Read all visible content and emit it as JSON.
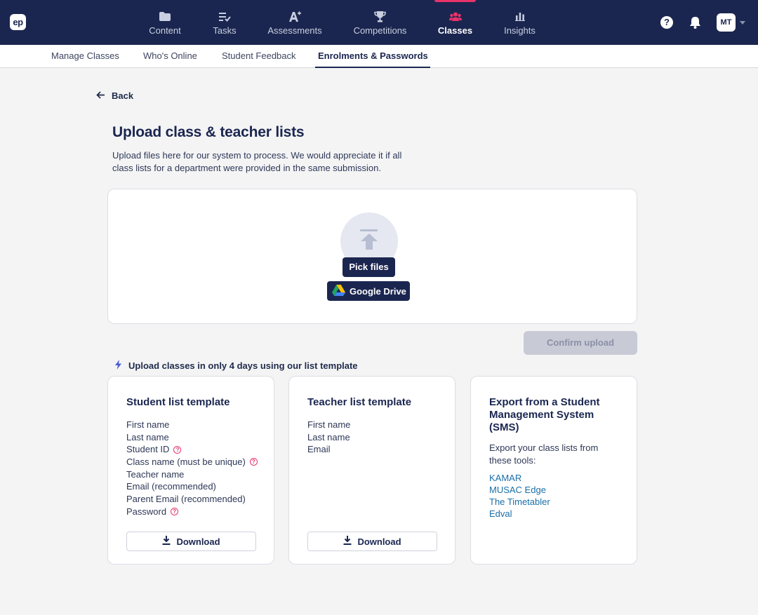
{
  "logo": "ep",
  "nav": {
    "items": [
      {
        "label": "Content",
        "icon": "folder-icon"
      },
      {
        "label": "Tasks",
        "icon": "tasks-icon"
      },
      {
        "label": "Assessments",
        "icon": "assessment-icon"
      },
      {
        "label": "Competitions",
        "icon": "trophy-icon"
      },
      {
        "label": "Classes",
        "icon": "people-icon",
        "active": true
      },
      {
        "label": "Insights",
        "icon": "chart-icon"
      }
    ],
    "help": "?",
    "avatar_initials": "MT",
    "active_color": "#e8336b",
    "bg_color": "#1b2650"
  },
  "subnav": {
    "tabs": [
      {
        "label": "Manage Classes"
      },
      {
        "label": "Who's Online"
      },
      {
        "label": "Student Feedback"
      },
      {
        "label": "Enrolments & Passwords",
        "active": true
      }
    ]
  },
  "back_label": "Back",
  "page": {
    "title": "Upload class & teacher lists",
    "description": "Upload files here for our system to process. We would appreciate it if all class lists for a department were provided in the same submission."
  },
  "upload": {
    "pick_files_label": "Pick files",
    "google_drive_label": "Google Drive",
    "confirm_label": "Confirm upload"
  },
  "promo_text": "Upload classes in only 4 days using our list template",
  "student_card": {
    "title": "Student list template",
    "fields": [
      "First name",
      "Last name",
      "Student ID",
      "Class name (must be unique)",
      "Teacher name",
      "Email (recommended)",
      "Parent Email (recommended)",
      "Password"
    ],
    "download_label": "Download"
  },
  "teacher_card": {
    "title": "Teacher list template",
    "fields": [
      "First name",
      "Last name",
      "Email"
    ],
    "download_label": "Download"
  },
  "sms_card": {
    "title": "Export from a Student Management System (SMS)",
    "description": "Export your class lists from these tools:",
    "links": [
      "KAMAR",
      "MUSAC Edge",
      "The Timetabler",
      "Edval"
    ],
    "link_color": "#1a6fa8"
  }
}
